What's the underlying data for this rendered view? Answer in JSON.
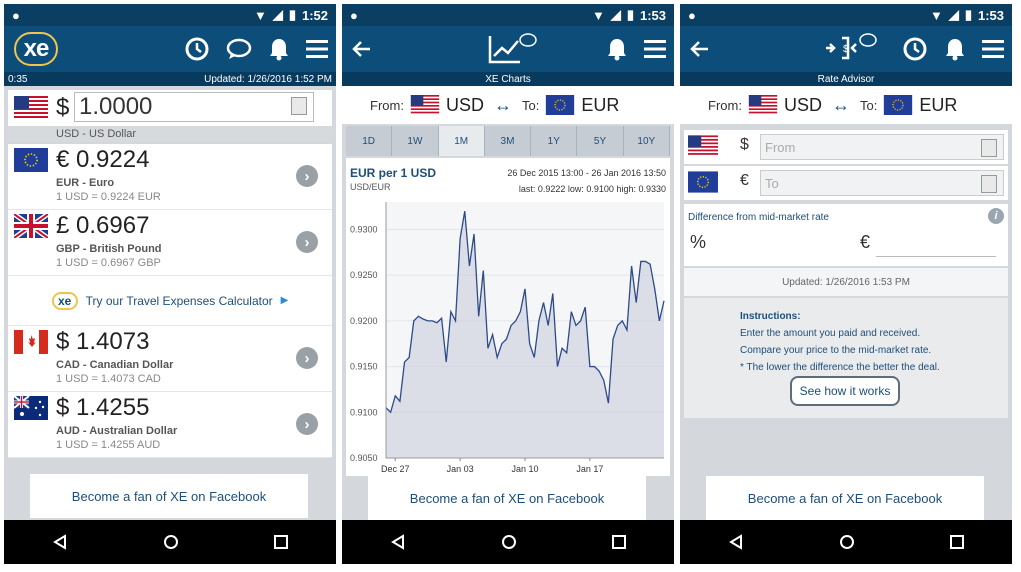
{
  "phones": [
    {
      "status": {
        "time": "1:52"
      },
      "subbar": {
        "left": "0:35",
        "right": "Updated:  1/26/2016 1:52 PM"
      },
      "logo": "xe",
      "base": {
        "symbol": "$",
        "amount": "1.0000",
        "name": "USD - US Dollar"
      },
      "currencies": [
        {
          "amount": "€ 0.9224",
          "name": "EUR - Euro",
          "rate": "1 USD = 0.9224 EUR"
        },
        {
          "amount": "£ 0.6967",
          "name": "GBP - British Pound",
          "rate": "1 USD = 0.6967 GBP"
        },
        {
          "amount": "$ 1.4073",
          "name": "CAD - Canadian Dollar",
          "rate": "1 USD = 1.4073 CAD"
        },
        {
          "amount": "$ 1.4255",
          "name": "AUD - Australian Dollar",
          "rate": "1 USD = 1.4255 AUD"
        }
      ],
      "promo": {
        "logo": "xe",
        "text": "Try our Travel Expenses Calculator"
      },
      "facebook": "Become a fan of XE on Facebook"
    },
    {
      "status": {
        "time": "1:53"
      },
      "subbar": {
        "title": "XE Charts"
      },
      "from_label": "From:",
      "from": "USD",
      "to_label": "To:",
      "to": "EUR",
      "ranges": [
        "1D",
        "1W",
        "1M",
        "3M",
        "1Y",
        "5Y",
        "10Y"
      ],
      "active_range": "1M",
      "facebook": "Become a fan of XE on Facebook"
    },
    {
      "status": {
        "time": "1:53"
      },
      "subbar": {
        "title": "Rate Advisor"
      },
      "from_label": "From:",
      "from": "USD",
      "to_label": "To:",
      "to": "EUR",
      "row1": {
        "symbol": "$",
        "placeholder": "From"
      },
      "row2": {
        "symbol": "€",
        "placeholder": "To"
      },
      "diff": {
        "label": "Difference from mid-market rate",
        "pct": "%",
        "symbol": "€"
      },
      "updated": "Updated:  1/26/2016 1:53 PM",
      "instructions": {
        "heading": "Instructions:",
        "lines": [
          "Enter the amount you paid and received.",
          "Compare your price to the mid-market rate.",
          "* The lower the difference the better the deal."
        ]
      },
      "button": "See how it works",
      "facebook": "Become a fan of XE on Facebook"
    }
  ],
  "chart_data": {
    "type": "line",
    "title": "EUR per 1 USD",
    "subtitle": "USD/EUR",
    "date_range": "26 Dec 2015 13:00 - 26 Jan 2016 13:50",
    "stats": {
      "last": "0.9222",
      "low": "0.9100",
      "high": "0.9330"
    },
    "x_ticks": [
      "Dec 27",
      "Jan 03",
      "Jan 10",
      "Jan 17"
    ],
    "y_ticks": [
      "0.9300",
      "0.9250",
      "0.9200",
      "0.9150",
      "0.9100",
      "0.9050"
    ],
    "ylim": [
      0.905,
      0.933
    ],
    "x": [
      0,
      1,
      2,
      3,
      4,
      5,
      6,
      7,
      8,
      9,
      10,
      11,
      12,
      13,
      14,
      15,
      16,
      17,
      18,
      19,
      20,
      21,
      22,
      23,
      24,
      25,
      26,
      27,
      28,
      29,
      30,
      31,
      32,
      33,
      34,
      35,
      36,
      37,
      38,
      39,
      40,
      41,
      42,
      43,
      44,
      45,
      46,
      47,
      48,
      49,
      50,
      51,
      52,
      53,
      54,
      55,
      56,
      57,
      58,
      59,
      60
    ],
    "values": [
      0.9105,
      0.91,
      0.9118,
      0.9112,
      0.9155,
      0.916,
      0.92,
      0.9205,
      0.9202,
      0.92,
      0.92,
      0.9198,
      0.9203,
      0.9155,
      0.921,
      0.92,
      0.929,
      0.932,
      0.926,
      0.9295,
      0.9205,
      0.9255,
      0.917,
      0.9185,
      0.916,
      0.9175,
      0.918,
      0.9195,
      0.92,
      0.921,
      0.9235,
      0.9175,
      0.916,
      0.92,
      0.922,
      0.9195,
      0.923,
      0.915,
      0.917,
      0.9165,
      0.921,
      0.9195,
      0.92,
      0.9215,
      0.915,
      0.915,
      0.9145,
      0.9135,
      0.911,
      0.918,
      0.9195,
      0.92,
      0.919,
      0.926,
      0.922,
      0.9265,
      0.9265,
      0.9262,
      0.9235,
      0.92,
      0.9222
    ]
  }
}
